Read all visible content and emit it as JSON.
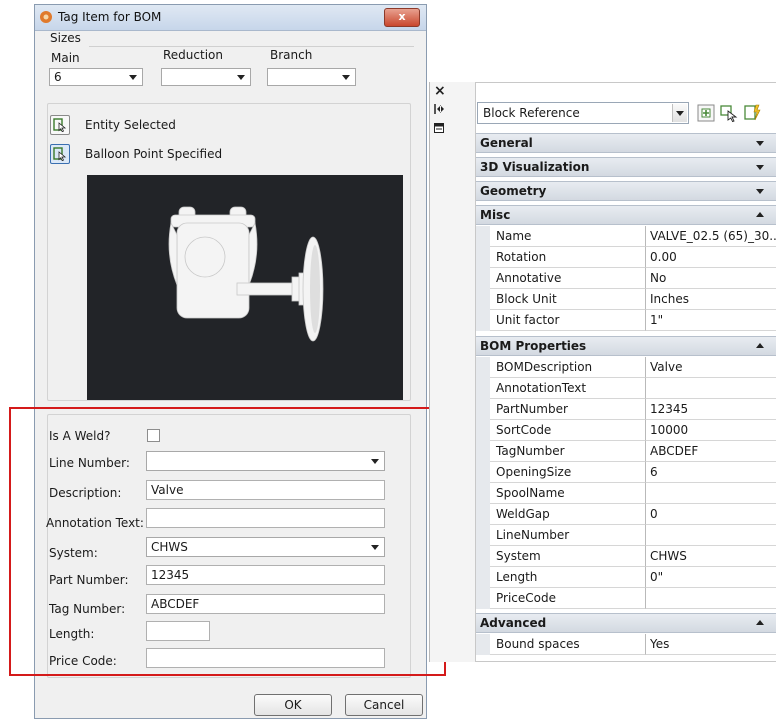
{
  "dialog": {
    "title": "Tag Item for BOM",
    "close_label": "x",
    "sizes": {
      "group_label": "Sizes",
      "main_label": "Main",
      "main_value": "6",
      "reduction_label": "Reduction",
      "reduction_value": "",
      "branch_label": "Branch",
      "branch_value": ""
    },
    "selection": {
      "entity_label": "Entity Selected",
      "balloon_label": "Balloon Point Specified"
    },
    "form": {
      "weld_label": "Is A Weld?",
      "line_number_label": "Line Number:",
      "line_number_value": "",
      "description_label": "Description:",
      "description_value": "Valve",
      "annotation_label": "Annotation Text:",
      "annotation_value": "",
      "system_label": "System:",
      "system_value": "CHWS",
      "part_number_label": "Part Number:",
      "part_number_value": "12345",
      "tag_number_label": "Tag Number:",
      "tag_number_value": "ABCDEF",
      "length_label": "Length:",
      "length_value": "",
      "price_code_label": "Price Code:",
      "price_code_value": ""
    },
    "buttons": {
      "ok": "OK",
      "cancel": "Cancel"
    }
  },
  "palette": {
    "close_glyph": "×",
    "block_reference": "Block Reference",
    "categories": {
      "general": "General",
      "visualization": "3D Visualization",
      "geometry": "Geometry",
      "misc": "Misc",
      "bom": "BOM Properties",
      "advanced": "Advanced"
    },
    "misc_rows": [
      {
        "name": "Name",
        "value": "VALVE_02.5 (65)_30..."
      },
      {
        "name": "Rotation",
        "value": "0.00"
      },
      {
        "name": "Annotative",
        "value": "No"
      },
      {
        "name": "Block Unit",
        "value": "Inches"
      },
      {
        "name": "Unit factor",
        "value": "1\""
      }
    ],
    "bom_rows": [
      {
        "name": "BOMDescription",
        "value": "Valve"
      },
      {
        "name": "AnnotationText",
        "value": ""
      },
      {
        "name": "PartNumber",
        "value": "12345"
      },
      {
        "name": "SortCode",
        "value": "10000"
      },
      {
        "name": "TagNumber",
        "value": "ABCDEF"
      },
      {
        "name": "OpeningSize",
        "value": "6"
      },
      {
        "name": "SpoolName",
        "value": ""
      },
      {
        "name": "WeldGap",
        "value": "0"
      },
      {
        "name": "LineNumber",
        "value": ""
      },
      {
        "name": "System",
        "value": "CHWS"
      },
      {
        "name": "Length",
        "value": "0\""
      },
      {
        "name": "PriceCode",
        "value": ""
      }
    ],
    "advanced_rows": [
      {
        "name": "Bound spaces",
        "value": "Yes"
      }
    ]
  }
}
